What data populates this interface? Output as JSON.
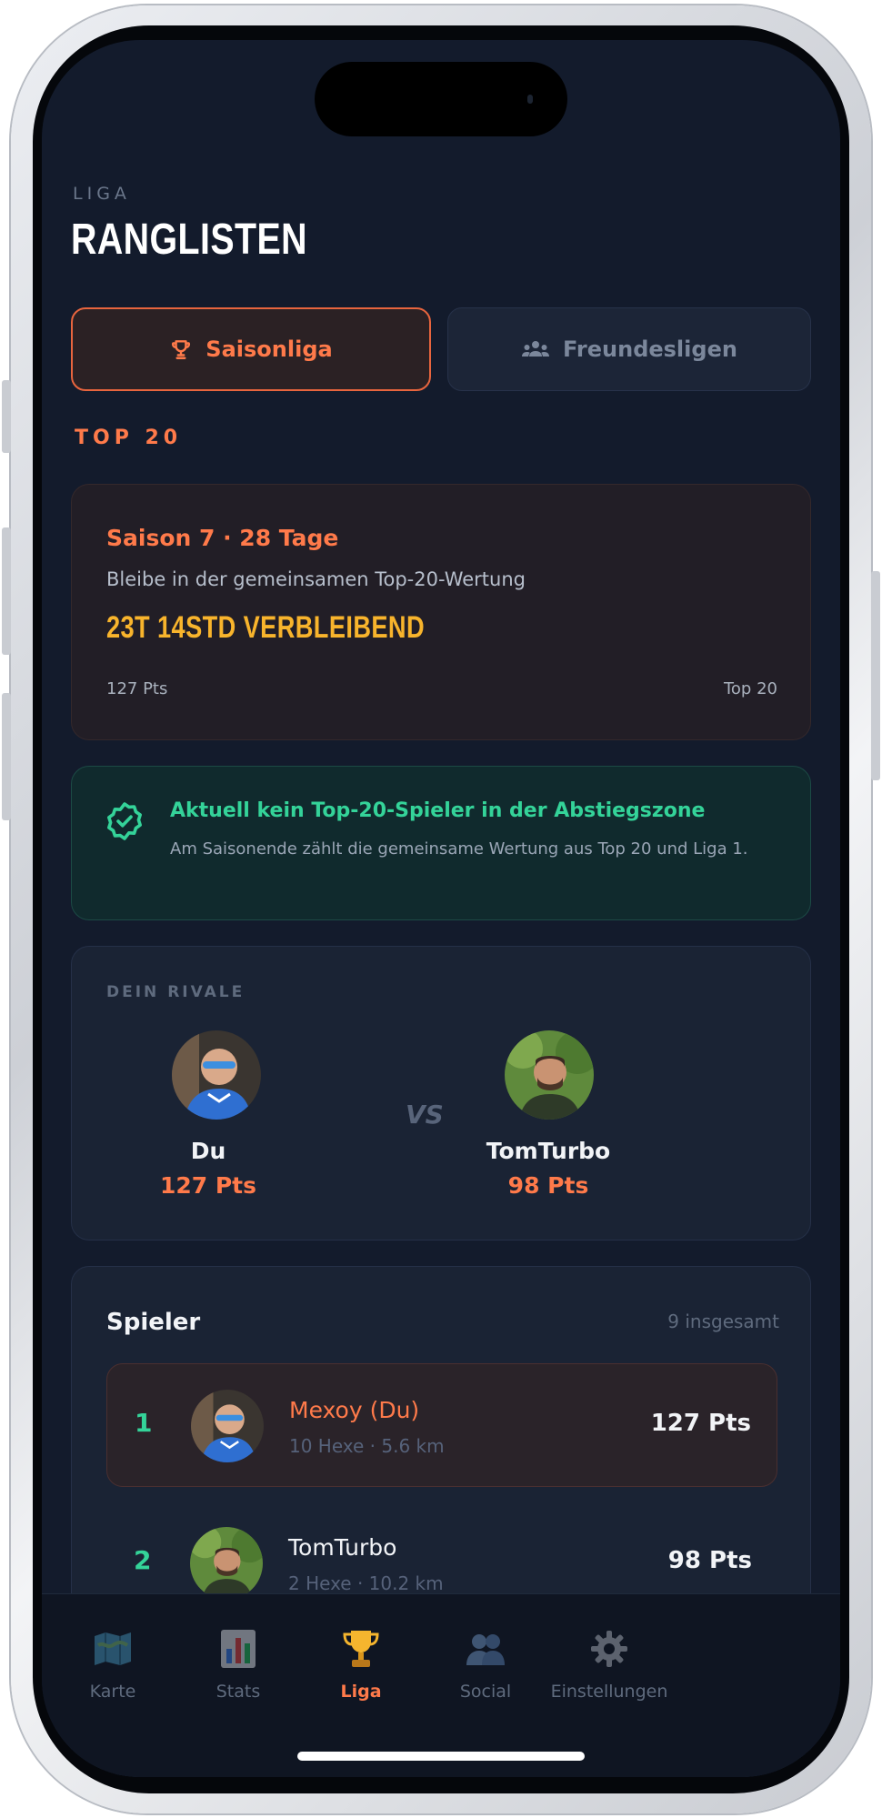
{
  "header": {
    "eyebrow": "LIGA",
    "title": "RANGLISTEN"
  },
  "segments": {
    "active_label": "Saisonliga",
    "inactive_label": "Freundesligen"
  },
  "section_label": "TOP 20",
  "season": {
    "title": "Saison 7 · 28 Tage",
    "subtitle": "Bleibe in der gemeinsamen Top-20-Wertung",
    "timer": "23T 14STD VERBLEIBEND",
    "points": "127 Pts",
    "tier": "Top 20"
  },
  "status": {
    "title": "Aktuell kein Top-20-Spieler in der Abstiegszone",
    "text": "Am Saisonende zählt die gemeinsame Wertung aus Top 20 und Liga 1."
  },
  "rival": {
    "label": "DEIN RIVALE",
    "vs": "VS",
    "me": {
      "name": "Du",
      "points": "127 Pts"
    },
    "opponent": {
      "name": "TomTurbo",
      "points": "98 Pts"
    }
  },
  "players": {
    "title": "Spieler",
    "count": "9 insgesamt",
    "rows": [
      {
        "rank": "1",
        "name": "Mexoy (Du)",
        "meta": "10 Hexe · 5.6 km",
        "points": "127 Pts"
      },
      {
        "rank": "2",
        "name": "TomTurbo",
        "meta": "2 Hexe · 10.2 km",
        "points": "98 Pts"
      }
    ]
  },
  "tabs": [
    {
      "label": "Karte",
      "icon": "map-icon"
    },
    {
      "label": "Stats",
      "icon": "bar-chart-icon"
    },
    {
      "label": "Liga",
      "icon": "trophy-icon",
      "active": true
    },
    {
      "label": "Social",
      "icon": "users-icon"
    },
    {
      "label": "Einstellungen",
      "icon": "gear-icon"
    }
  ],
  "colors": {
    "accent": "#ff7a4a",
    "success": "#34d399",
    "warning": "#f8b42c",
    "background": "#131b2c"
  }
}
